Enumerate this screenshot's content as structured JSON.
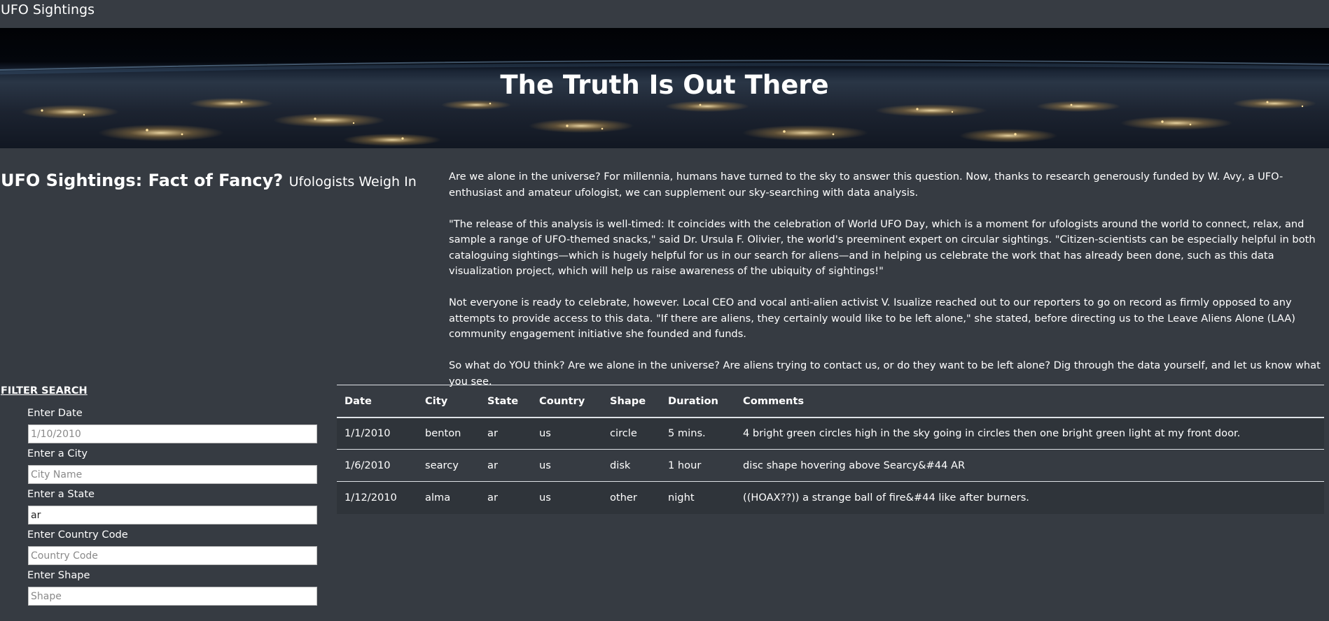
{
  "navbar": {
    "brand": "UFO Sightings"
  },
  "hero": {
    "title": "The Truth Is Out There"
  },
  "headline": {
    "main": "UFO Sightings: Fact of Fancy?",
    "sub": "Ufologists Weigh In"
  },
  "article": {
    "paragraphs": [
      "Are we alone in the universe? For millennia, humans have turned to the sky to answer this question. Now, thanks to research generously funded by W. Avy, a UFO-enthusiast and amateur ufologist, we can supplement our sky-searching with data analysis.",
      "\"The release of this analysis is well-timed: It coincides with the celebration of World UFO Day, which is a moment for ufologists around the world to connect, relax, and sample a range of UFO-themed snacks,\" said Dr. Ursula F. Olivier, the world's preeminent expert on circular sightings. \"Citizen-scientists can be especially helpful in both cataloguing sightings—which is hugely helpful for us in our search for aliens—and in helping us celebrate the work that has already been done, such as this data visualization project, which will help us raise awareness of the ubiquity of sightings!\"",
      "Not everyone is ready to celebrate, however. Local CEO and vocal anti-alien activist V. Isualize reached out to our reporters to go on record as firmly opposed to any attempts to provide access to this data. \"If there are aliens, they certainly would like to be left alone,\" she stated, before directing us to the Leave Aliens Alone (LAA) community engagement initiative she founded and funds.",
      "So what do YOU think? Are we alone in the universe? Are aliens trying to contact us, or do they want to be left alone? Dig through the data yourself, and let us know what you see."
    ]
  },
  "filters": {
    "heading": "FILTER SEARCH",
    "date": {
      "label": "Enter Date",
      "placeholder": "1/10/2010",
      "value": ""
    },
    "city": {
      "label": "Enter a City",
      "placeholder": "City Name",
      "value": ""
    },
    "state": {
      "label": "Enter a State",
      "placeholder": "State",
      "value": "ar"
    },
    "country": {
      "label": "Enter Country Code",
      "placeholder": "Country Code",
      "value": ""
    },
    "shape": {
      "label": "Enter Shape",
      "placeholder": "Shape",
      "value": ""
    }
  },
  "table": {
    "headers": [
      "Date",
      "City",
      "State",
      "Country",
      "Shape",
      "Duration",
      "Comments"
    ],
    "rows": [
      [
        "1/1/2010",
        "benton",
        "ar",
        "us",
        "circle",
        "5 mins.",
        "4 bright green circles high in the sky going in circles then one bright green light at my front door."
      ],
      [
        "1/6/2010",
        "searcy",
        "ar",
        "us",
        "disk",
        "1 hour",
        "disc shape hovering above Searcy&#44 AR"
      ],
      [
        "1/12/2010",
        "alma",
        "ar",
        "us",
        "other",
        "night",
        "((HOAX??)) a strange ball of fire&#44 like after burners."
      ]
    ]
  }
}
